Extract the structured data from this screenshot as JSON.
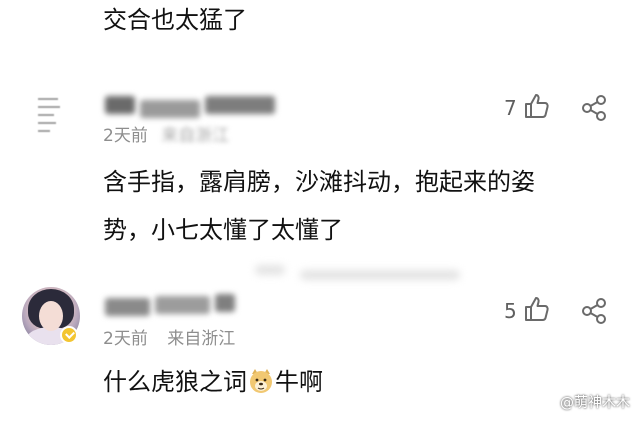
{
  "top_comment": {
    "text": "交合也太猛了"
  },
  "comments": [
    {
      "time": "2天前",
      "location": "来自浙江",
      "likes": "7",
      "text": "含手指，露肩膀，沙滩抖动，抱起来的姿势，小七太懂了太懂了",
      "line1": "含手指，露肩膀，沙滩抖动，抱起来的姿",
      "line2": "势，小七太懂了太懂了"
    },
    {
      "time": "2天前",
      "location": "来自浙江",
      "likes": "5",
      "text_before_emoji": "什么虎狼之词",
      "text_after_emoji": "牛啊",
      "emoji": "doge-emoji"
    }
  ],
  "icons": {
    "like": "thumbs-up-icon",
    "share": "share-icon",
    "badge": "verified-badge-icon",
    "watermark": "toutiao-logo-icon"
  },
  "watermark": {
    "text": "@萌神木木"
  },
  "colors": {
    "text": "#111111",
    "meta": "#8e8e8e",
    "icon": "#6a6a6a",
    "badge": "#f3c531"
  }
}
